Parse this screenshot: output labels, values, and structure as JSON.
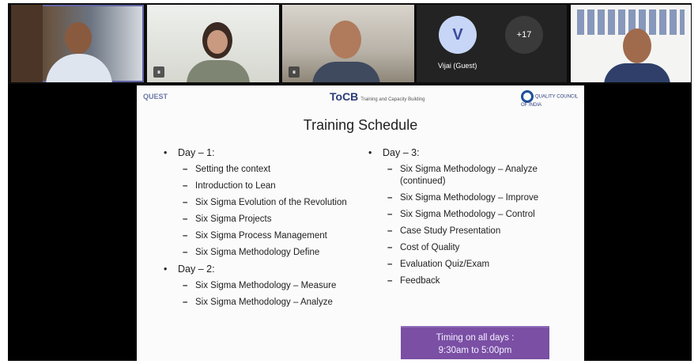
{
  "participants": {
    "guest_initial": "V",
    "guest_name": "Vijai (Guest)",
    "more_count": "+17"
  },
  "slide": {
    "logo_left": "QUEST",
    "logo_mid": "ToCB",
    "logo_mid_small": "Training and Capacity Building",
    "logo_right": "QUALITY COUNCIL OF INDIA",
    "title": "Training Schedule",
    "day1": {
      "label": "Day – 1:",
      "items": [
        "Setting the context",
        "Introduction to Lean",
        "Six Sigma Evolution of the Revolution",
        "Six Sigma Projects",
        "Six Sigma Process Management",
        "Six Sigma Methodology Define"
      ]
    },
    "day2": {
      "label": "Day – 2:",
      "items": [
        "Six Sigma Methodology – Measure",
        "Six Sigma Methodology – Analyze"
      ]
    },
    "day3": {
      "label": "Day – 3:",
      "items": [
        "Six Sigma Methodology – Analyze (continued)",
        "Six Sigma Methodology – Improve",
        "Six Sigma Methodology – Control",
        "Case Study Presentation",
        "Cost of Quality",
        "Evaluation Quiz/Exam",
        "Feedback"
      ]
    },
    "timing_line1": "Timing on all days :",
    "timing_line2": "9:30am to 5:00pm"
  },
  "colors": {
    "speaker_outline": "#6264a7",
    "timing_bg": "#7a4fa4"
  }
}
